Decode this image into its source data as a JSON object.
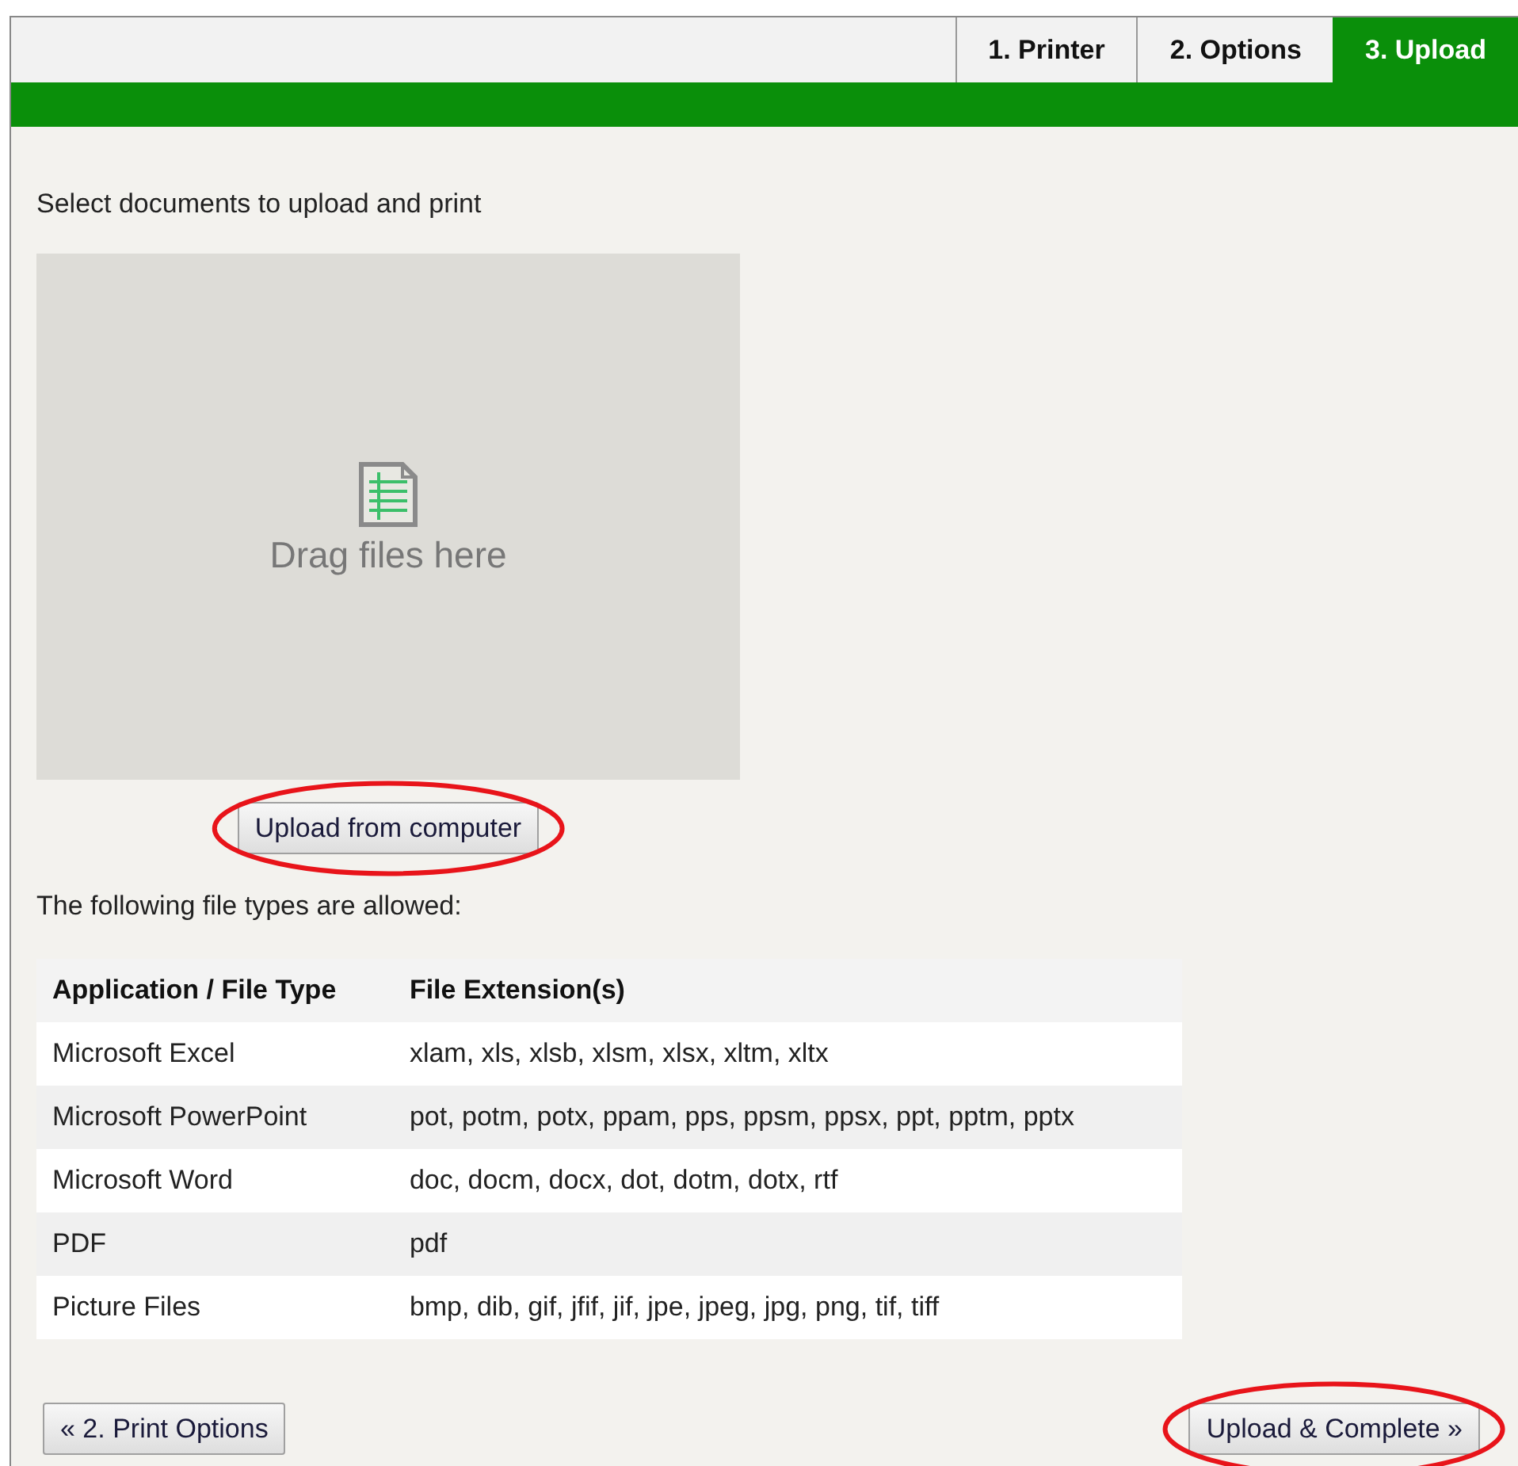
{
  "tabs": [
    {
      "label": "1. Printer",
      "selected": false
    },
    {
      "label": "2. Options",
      "selected": false
    },
    {
      "label": "3. Upload",
      "selected": true
    }
  ],
  "instruction": "Select documents to upload and print",
  "drop_zone": {
    "label": "Drag files here"
  },
  "upload_button": {
    "label": "Upload from computer",
    "highlighted": true
  },
  "allowed_note": "The following file types are allowed:",
  "table": {
    "columns": [
      "Application / File Type",
      "File Extension(s)"
    ],
    "rows": [
      [
        "Microsoft Excel",
        "xlam, xls, xlsb, xlsm, xlsx, xltm, xltx"
      ],
      [
        "Microsoft PowerPoint",
        "pot, potm, potx, ppam, pps, ppsm, ppsx, ppt, pptm, pptx"
      ],
      [
        "Microsoft Word",
        "doc, docm, docx, dot, dotm, dotx, rtf"
      ],
      [
        "PDF",
        "pdf"
      ],
      [
        "Picture Files",
        "bmp, dib, gif, jfif, jif, jpe, jpeg, jpg, png, tif, tiff"
      ]
    ]
  },
  "back_button": {
    "label": "« 2. Print Options",
    "highlighted": false
  },
  "next_button": {
    "label": "Upload & Complete »",
    "highlighted": true
  }
}
